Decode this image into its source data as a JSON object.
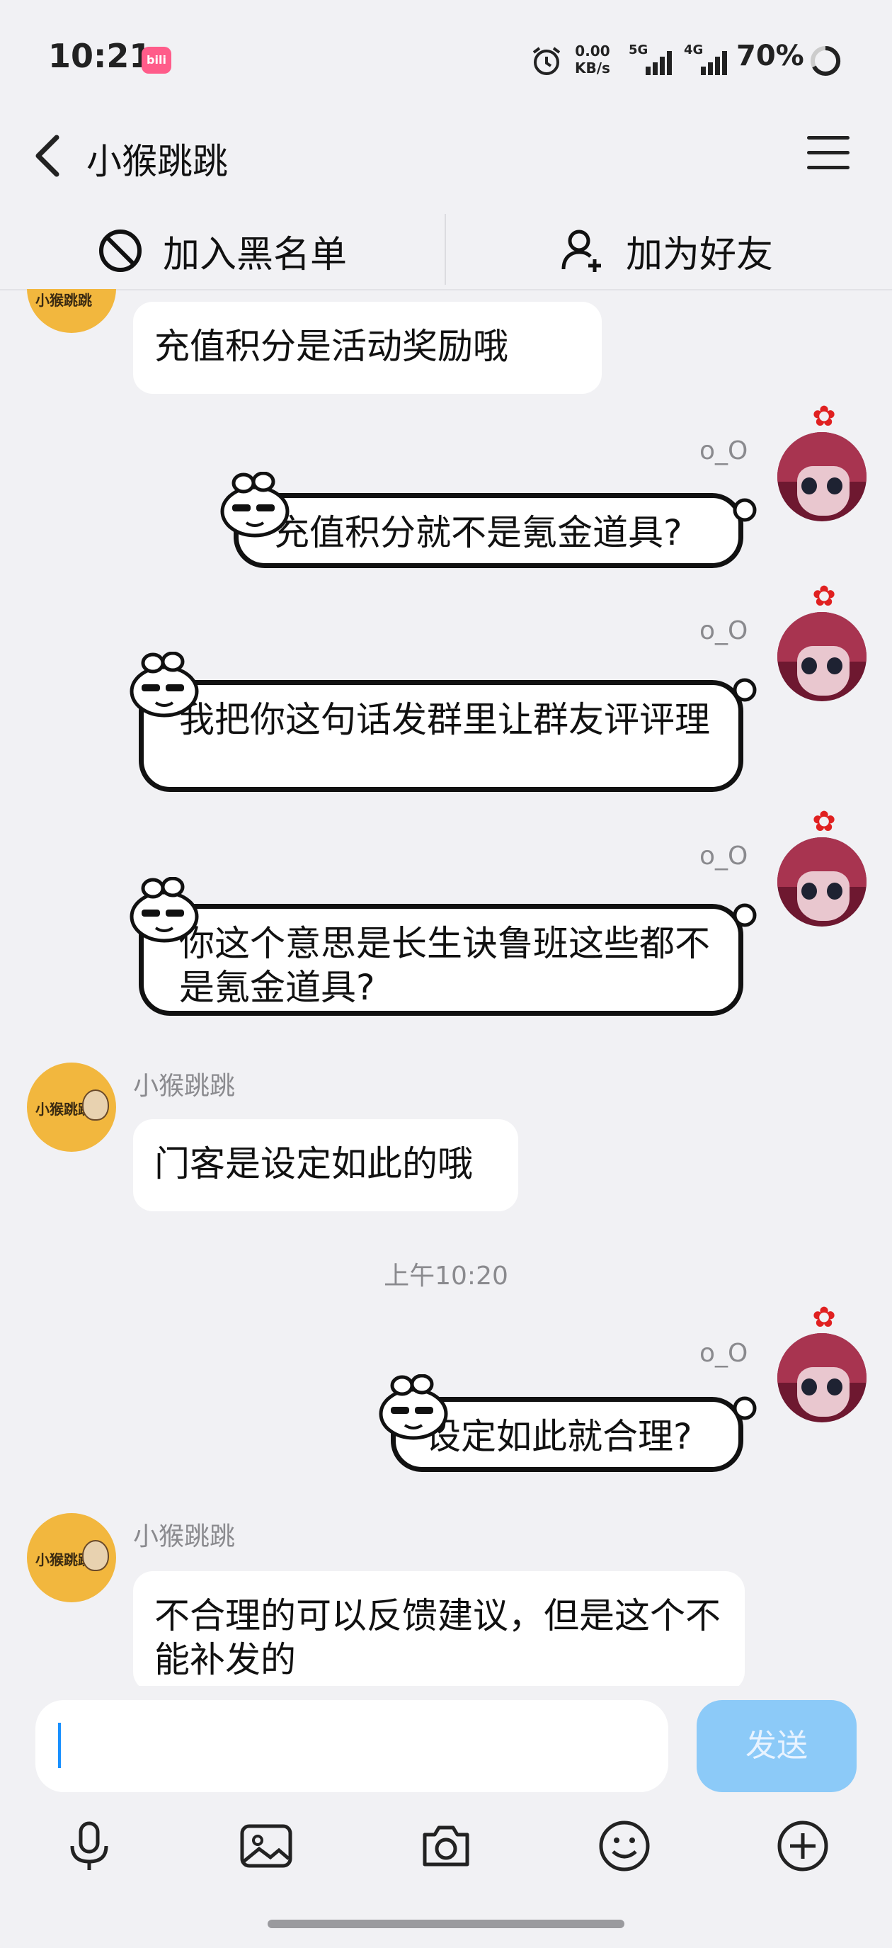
{
  "status_bar": {
    "time": "10:21",
    "app_badge": "bili",
    "net_speed_value": "0.00",
    "net_speed_unit": "KB/s",
    "net1": "5G",
    "net2": "4G",
    "battery": "70%"
  },
  "header": {
    "title": "小猴跳跳"
  },
  "actions": {
    "block_label": "加入黑名单",
    "add_friend_label": "加为好友"
  },
  "messages": [
    {
      "side": "left",
      "nick": "",
      "text": "充值积分是活动奖励哦"
    },
    {
      "side": "right",
      "nick": "o_O",
      "text": "充值积分就不是氪金道具?"
    },
    {
      "side": "right",
      "nick": "o_O",
      "text": "我把你这句话发群里让群友评评理"
    },
    {
      "side": "right",
      "nick": "o_O",
      "text": "你这个意思是长生诀鲁班这些都不是氪金道具?"
    },
    {
      "side": "left",
      "nick": "小猴跳跳",
      "text": "门客是设定如此的哦"
    },
    {
      "side": "right",
      "nick": "o_O",
      "text": "设定如此就合理?"
    },
    {
      "side": "left",
      "nick": "小猴跳跳",
      "text": "不合理的可以反馈建议，但是这个不能补发的"
    }
  ],
  "timestamp": "上午10:20",
  "input": {
    "value": "",
    "send_label": "发送"
  },
  "toolbar": [
    "microphone-icon",
    "image-icon",
    "camera-icon",
    "emoji-icon",
    "plus-icon"
  ],
  "colors": {
    "background": "#f1f1f4",
    "send_button": "#8ccaf8",
    "caret": "#1890ff",
    "avatar_left": "#f2b73e",
    "avatar_right": "#6e1830"
  }
}
